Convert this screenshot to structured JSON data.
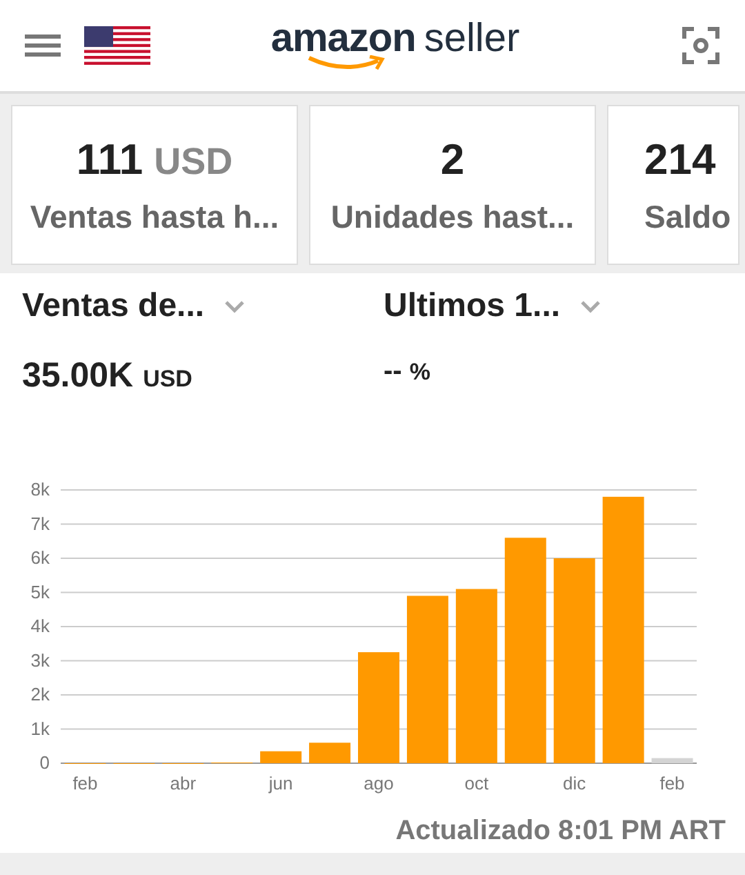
{
  "header": {
    "logo_brand": "amazon",
    "logo_product": "seller"
  },
  "cards": [
    {
      "value": "111",
      "unit": "USD",
      "label": "Ventas hasta h..."
    },
    {
      "value": "2",
      "label": "Unidades hast..."
    },
    {
      "value": "214",
      "label": "Saldo"
    }
  ],
  "metrics": [
    {
      "selector": "Ventas de...",
      "value": "35.00K",
      "unit": "USD"
    },
    {
      "selector": "Ultimos 1...",
      "value": "--",
      "unit": "%"
    }
  ],
  "chart_data": {
    "type": "bar",
    "categories": [
      "feb",
      null,
      "abr",
      null,
      "jun",
      null,
      "ago",
      null,
      "oct",
      null,
      "dic",
      null,
      "feb"
    ],
    "series": [
      {
        "color": "#ff9900",
        "values": [
          0,
          0,
          0,
          20,
          350,
          600,
          3250,
          4900,
          5100,
          6600,
          6000,
          7800,
          null
        ]
      },
      {
        "color": "#d4d4d4",
        "values": [
          null,
          null,
          null,
          null,
          null,
          null,
          null,
          null,
          null,
          null,
          null,
          null,
          150
        ]
      }
    ],
    "ylim": [
      0,
      8000
    ],
    "yticks": [
      {
        "value": 0,
        "label": "0"
      },
      {
        "value": 1000,
        "label": "1k"
      },
      {
        "value": 2000,
        "label": "2k"
      },
      {
        "value": 3000,
        "label": "3k"
      },
      {
        "value": 4000,
        "label": "4k"
      },
      {
        "value": 5000,
        "label": "5k"
      },
      {
        "value": 6000,
        "label": "6k"
      },
      {
        "value": 7000,
        "label": "7k"
      },
      {
        "value": 8000,
        "label": "8k"
      }
    ],
    "stacked": true,
    "grid": true
  },
  "updated": "Actualizado 8:01 PM ART"
}
